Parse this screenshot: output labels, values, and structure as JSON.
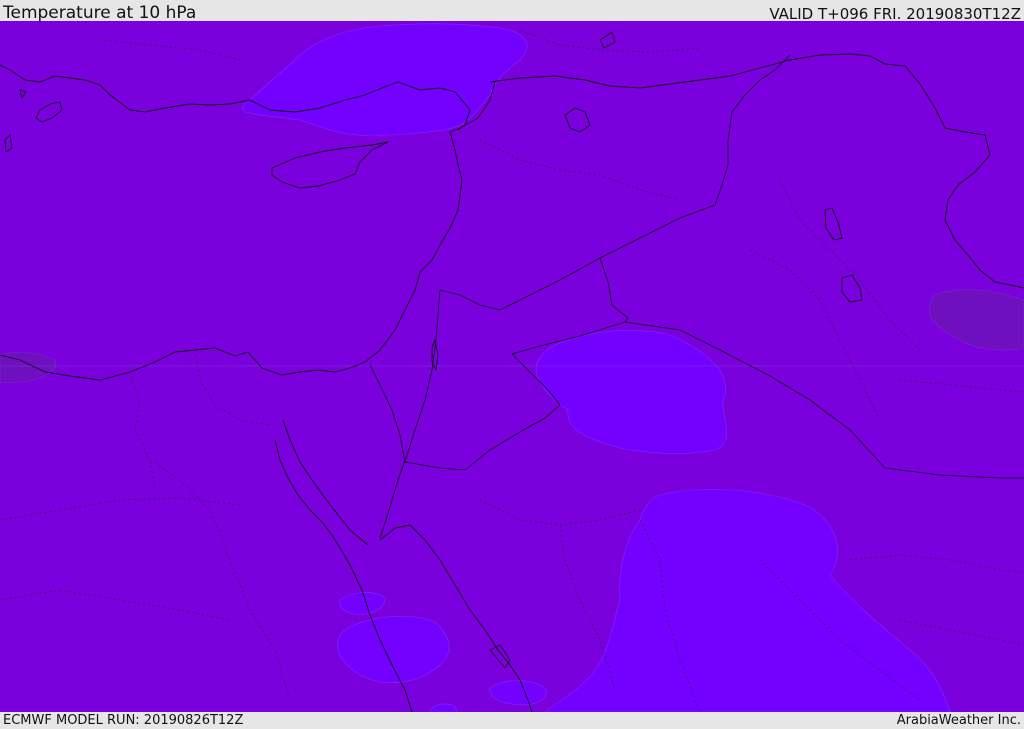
{
  "header": {
    "title": "Temperature at 10 hPa",
    "valid": "VALID T+096 FRI. 20190830T12Z"
  },
  "footer": {
    "model_run": "ECMWF MODEL RUN: 20190826T12Z",
    "credit": "ArabiaWeather Inc."
  },
  "colors": {
    "base_field": "#7a00dd",
    "warm_field": "#7400ff",
    "cool_field": "#6e10c0",
    "coastline": "#111111"
  }
}
